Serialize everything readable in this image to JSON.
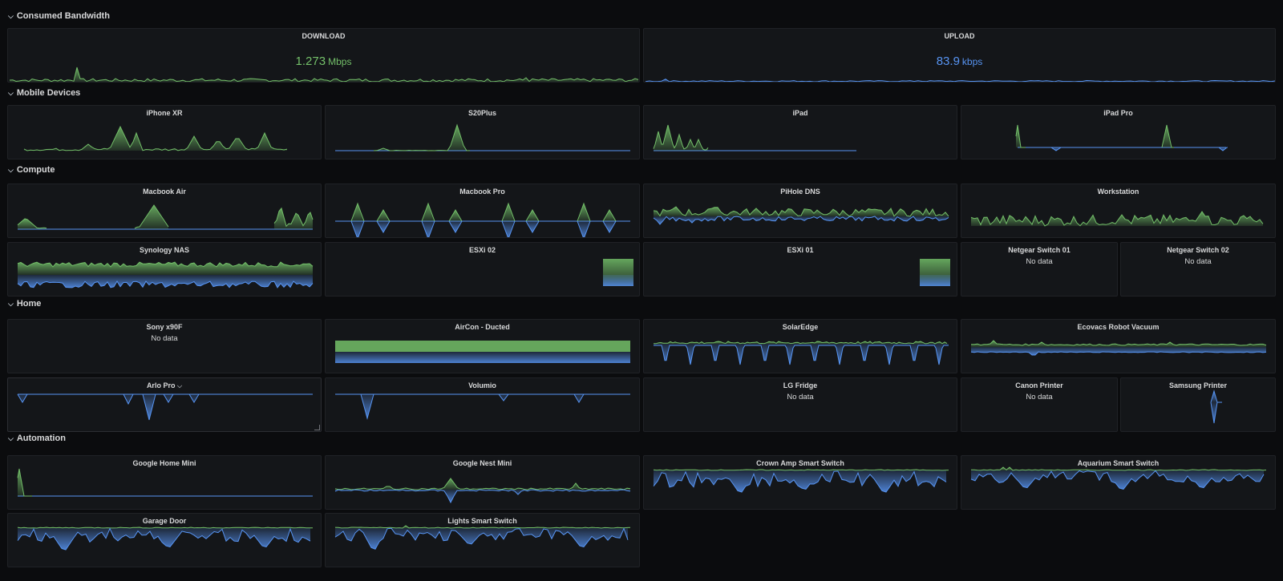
{
  "colors": {
    "green": "#73bf69",
    "blue": "#5794f2",
    "panel": "#141619"
  },
  "rows": [
    {
      "label": "Consumed Bandwidth",
      "icon": "chevron-down-icon"
    },
    {
      "label": "Mobile Devices",
      "icon": "chevron-down-icon"
    },
    {
      "label": "Compute",
      "icon": "chevron-down-icon"
    },
    {
      "label": "Home",
      "icon": "chevron-down-icon"
    },
    {
      "label": "Automation",
      "icon": "chevron-down-icon"
    }
  ],
  "bandwidth": {
    "download": {
      "title": "DOWNLOAD",
      "value": "1.273",
      "unit": "Mbps"
    },
    "upload": {
      "title": "UPLOAD",
      "value": "83.9",
      "unit": "kbps"
    }
  },
  "panels": {
    "iphone_xr": {
      "title": "iPhone XR"
    },
    "s20plus": {
      "title": "S20Plus"
    },
    "ipad": {
      "title": "iPad"
    },
    "ipad_pro": {
      "title": "iPad Pro"
    },
    "macbook_air": {
      "title": "Macbook Air"
    },
    "macbook_pro": {
      "title": "Macbook Pro"
    },
    "pihole_dns": {
      "title": "PiHole DNS"
    },
    "workstation": {
      "title": "Workstation"
    },
    "synology_nas": {
      "title": "Synology NAS"
    },
    "esxi_02": {
      "title": "ESXi 02"
    },
    "esxi_01": {
      "title": "ESXi 01"
    },
    "netgear_01": {
      "title": "Netgear Switch 01",
      "status": "No data"
    },
    "netgear_02": {
      "title": "Netgear Switch 02",
      "status": "No data"
    },
    "sony_x90f": {
      "title": "Sony x90F",
      "status": "No data"
    },
    "aircon": {
      "title": "AirCon - Ducted"
    },
    "solaredge": {
      "title": "SolarEdge"
    },
    "ecovacs": {
      "title": "Ecovacs Robot Vacuum"
    },
    "arlo_pro": {
      "title": "Arlo Pro",
      "menu_icon": "chevron-down-icon"
    },
    "volumio": {
      "title": "Volumio"
    },
    "lg_fridge": {
      "title": "LG Fridge",
      "status": "No data"
    },
    "canon_printer": {
      "title": "Canon Printer",
      "status": "No data"
    },
    "samsung_printer": {
      "title": "Samsung Printer"
    },
    "google_home_mini": {
      "title": "Google Home Mini"
    },
    "google_nest_mini": {
      "title": "Google Nest Mini"
    },
    "crown_amp": {
      "title": "Crown Amp Smart Switch"
    },
    "aquarium": {
      "title": "Aquarium Smart Switch"
    },
    "garage_door": {
      "title": "Garage Door"
    },
    "lights_switch": {
      "title": "Lights Smart Switch"
    }
  }
}
